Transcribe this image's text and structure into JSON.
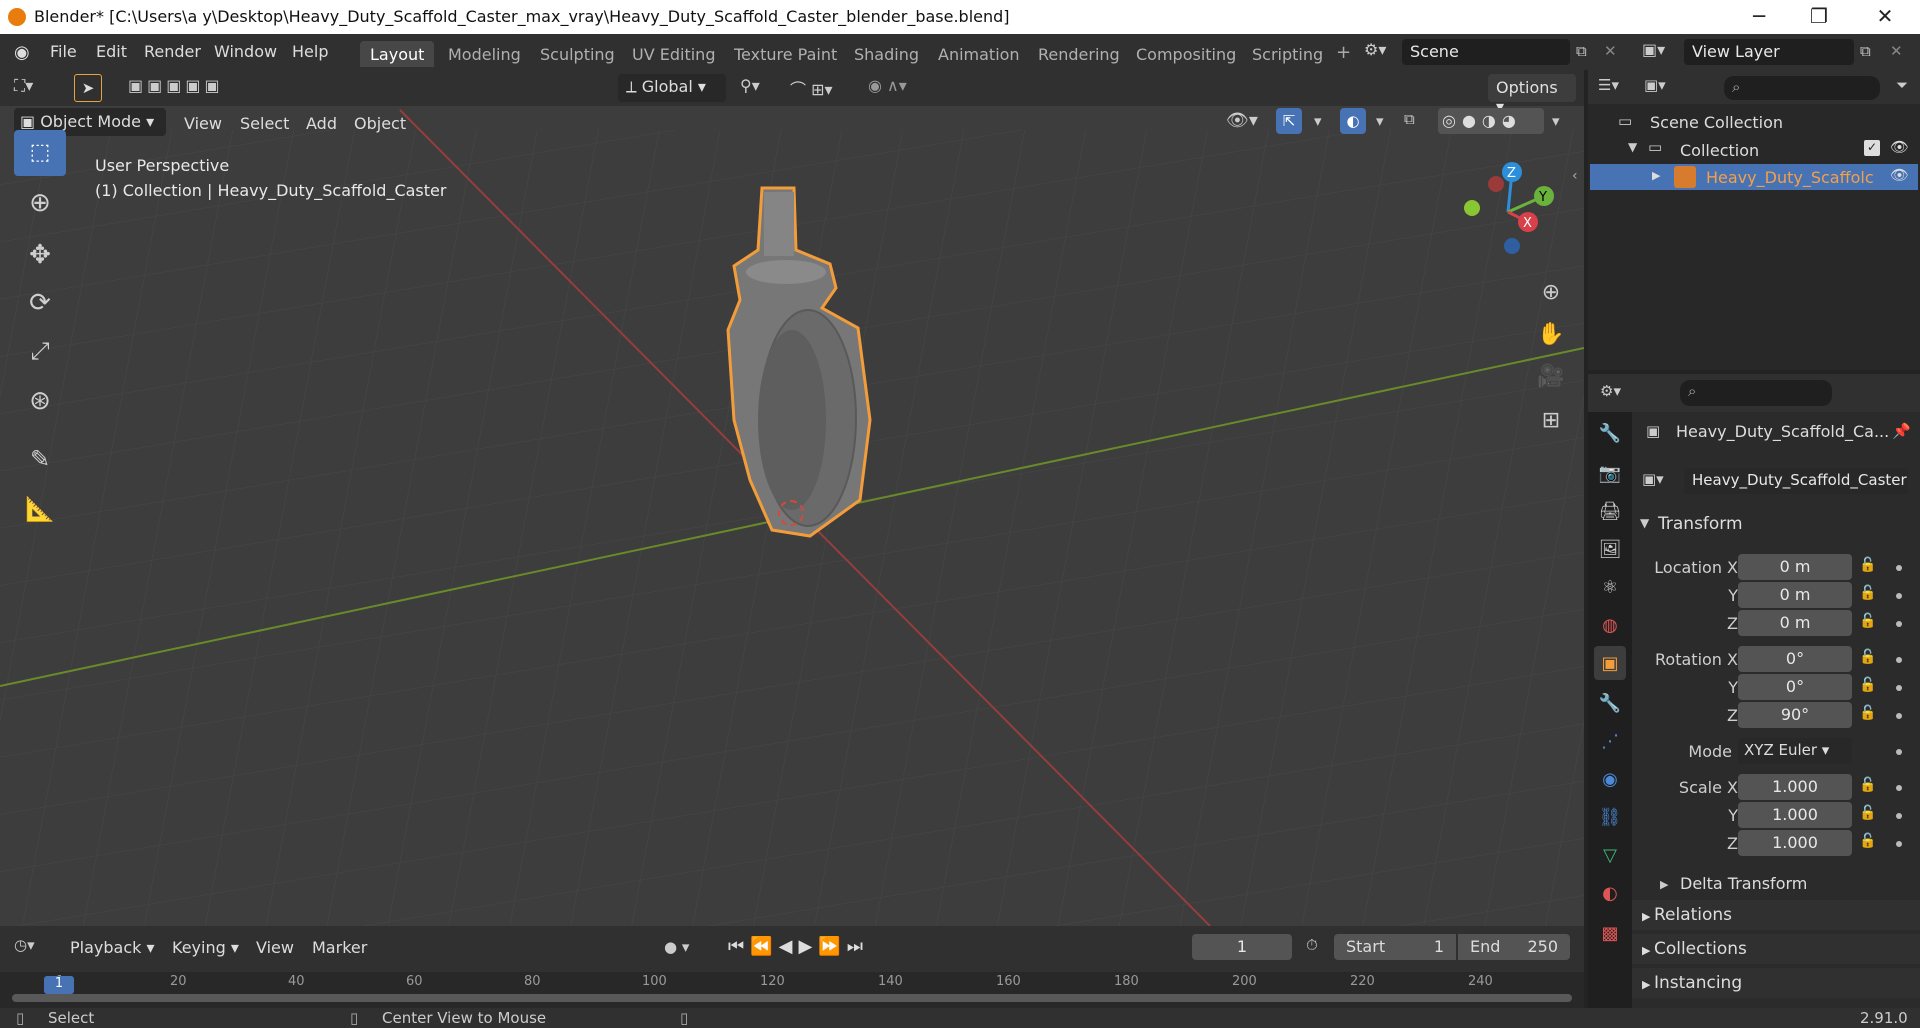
{
  "window": {
    "title": "Blender* [C:\\Users\\a y\\Desktop\\Heavy_Duty_Scaffold_Caster_max_vray\\Heavy_Duty_Scaffold_Caster_blender_base.blend]",
    "minimize": "─",
    "maximize": "❐",
    "close": "✕"
  },
  "menu": {
    "file": "File",
    "edit": "Edit",
    "render": "Render",
    "window": "Window",
    "help": "Help"
  },
  "workspaces": [
    "Layout",
    "Modeling",
    "Sculpting",
    "UV Editing",
    "Texture Paint",
    "Shading",
    "Animation",
    "Rendering",
    "Compositing",
    "Scripting"
  ],
  "scene": {
    "name": "Scene",
    "view_layer": "View Layer"
  },
  "viewport": {
    "mode": "Object Mode",
    "menus": [
      "View",
      "Select",
      "Add",
      "Object"
    ],
    "transform_orientation": "Global",
    "options": "Options",
    "info_line1": "User Perspective",
    "info_line2": "(1) Collection | Heavy_Duty_Scaffold_Caster",
    "gizmo": {
      "x": "X",
      "y": "Y",
      "z": "Z"
    }
  },
  "outliner": {
    "scene_collection": "Scene Collection",
    "collection": "Collection",
    "object": "Heavy_Duty_Scaffolc"
  },
  "properties": {
    "object_name_short": "Heavy_Duty_Scaffold_Ca...",
    "object_name": "Heavy_Duty_Scaffold_Caster",
    "transform": "Transform",
    "location": {
      "label": "Location X",
      "x": "0 m",
      "y": "0 m",
      "z": "0 m"
    },
    "rotation": {
      "label": "Rotation X",
      "x": "0°",
      "y": "0°",
      "z": "90°"
    },
    "mode_label": "Mode",
    "mode": "XYZ Euler",
    "scale": {
      "label": "Scale X",
      "x": "1.000",
      "y": "1.000",
      "z": "1.000"
    },
    "axis_y": "Y",
    "axis_z": "Z",
    "delta": "Delta Transform",
    "relations": "Relations",
    "collections": "Collections",
    "instancing": "Instancing"
  },
  "timeline": {
    "menus": [
      "Playback",
      "Keying",
      "View",
      "Marker"
    ],
    "current_frame": "1",
    "start_label": "Start",
    "start": "1",
    "end_label": "End",
    "end": "250",
    "ticks": [
      "1",
      "20",
      "40",
      "60",
      "80",
      "100",
      "120",
      "140",
      "160",
      "180",
      "200",
      "220",
      "240"
    ]
  },
  "status": {
    "select": "Select",
    "center": "Center View to Mouse",
    "version": "2.91.0"
  }
}
